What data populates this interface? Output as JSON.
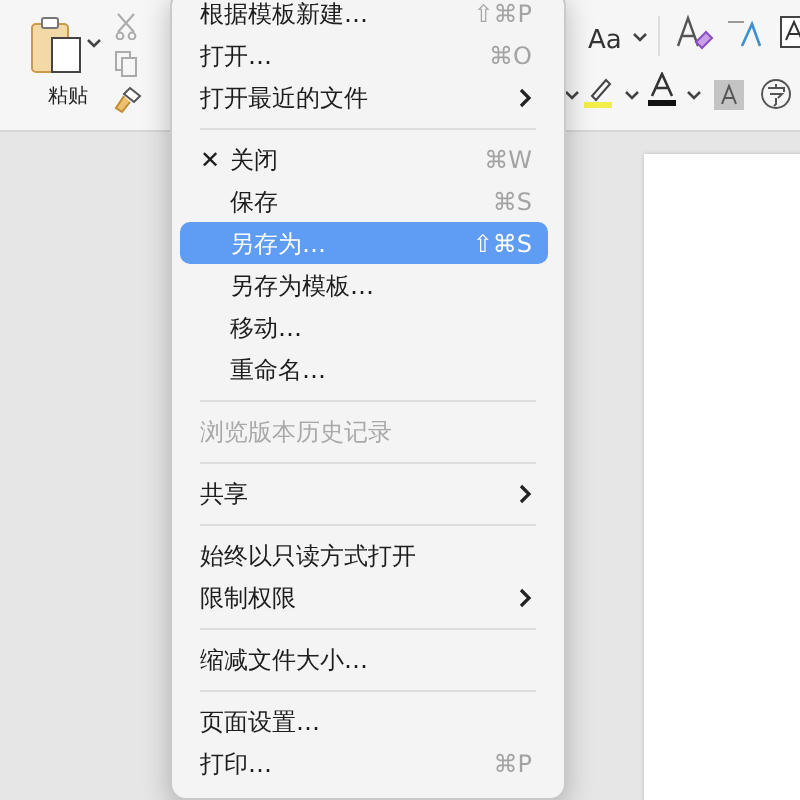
{
  "ribbon": {
    "paste_label": "粘贴",
    "change_case_label": "Aa"
  },
  "menu": {
    "items": [
      {
        "kind": "item",
        "label": "根据模板新建…",
        "shortcut": "⇧⌘P",
        "indented": false,
        "disabled": false,
        "selected": false,
        "submenu": false
      },
      {
        "kind": "item",
        "label": "打开…",
        "shortcut": "⌘O",
        "indented": false,
        "disabled": false,
        "selected": false,
        "submenu": false
      },
      {
        "kind": "item",
        "label": "打开最近的文件",
        "indented": false,
        "disabled": false,
        "selected": false,
        "submenu": true
      },
      {
        "kind": "separator"
      },
      {
        "kind": "item",
        "mark": "✕",
        "label": "关闭",
        "shortcut": "⌘W",
        "disabled": false,
        "selected": false,
        "submenu": false
      },
      {
        "kind": "item",
        "label": "保存",
        "shortcut": "⌘S",
        "indented": true,
        "disabled": false,
        "selected": false,
        "submenu": false
      },
      {
        "kind": "item",
        "label": "另存为…",
        "shortcut": "⇧⌘S",
        "indented": true,
        "disabled": false,
        "selected": true,
        "submenu": false
      },
      {
        "kind": "item",
        "label": "另存为模板…",
        "indented": true,
        "disabled": false,
        "selected": false,
        "submenu": false
      },
      {
        "kind": "item",
        "label": "移动…",
        "indented": true,
        "disabled": false,
        "selected": false,
        "submenu": false
      },
      {
        "kind": "item",
        "label": "重命名…",
        "indented": true,
        "disabled": false,
        "selected": false,
        "submenu": false
      },
      {
        "kind": "separator"
      },
      {
        "kind": "item",
        "label": "浏览版本历史记录",
        "indented": false,
        "disabled": true,
        "selected": false,
        "submenu": false
      },
      {
        "kind": "separator"
      },
      {
        "kind": "item",
        "label": "共享",
        "indented": false,
        "disabled": false,
        "selected": false,
        "submenu": true
      },
      {
        "kind": "separator"
      },
      {
        "kind": "item",
        "label": "始终以只读方式打开",
        "indented": false,
        "disabled": false,
        "selected": false,
        "submenu": false
      },
      {
        "kind": "item",
        "label": "限制权限",
        "indented": false,
        "disabled": false,
        "selected": false,
        "submenu": true
      },
      {
        "kind": "separator"
      },
      {
        "kind": "item",
        "label": "缩减文件大小…",
        "indented": false,
        "disabled": false,
        "selected": false,
        "submenu": false
      },
      {
        "kind": "separator"
      },
      {
        "kind": "item",
        "label": "页面设置…",
        "indented": false,
        "disabled": false,
        "selected": false,
        "submenu": false
      },
      {
        "kind": "item",
        "label": "打印…",
        "shortcut": "⌘P",
        "indented": false,
        "disabled": false,
        "selected": false,
        "submenu": false
      }
    ]
  }
}
